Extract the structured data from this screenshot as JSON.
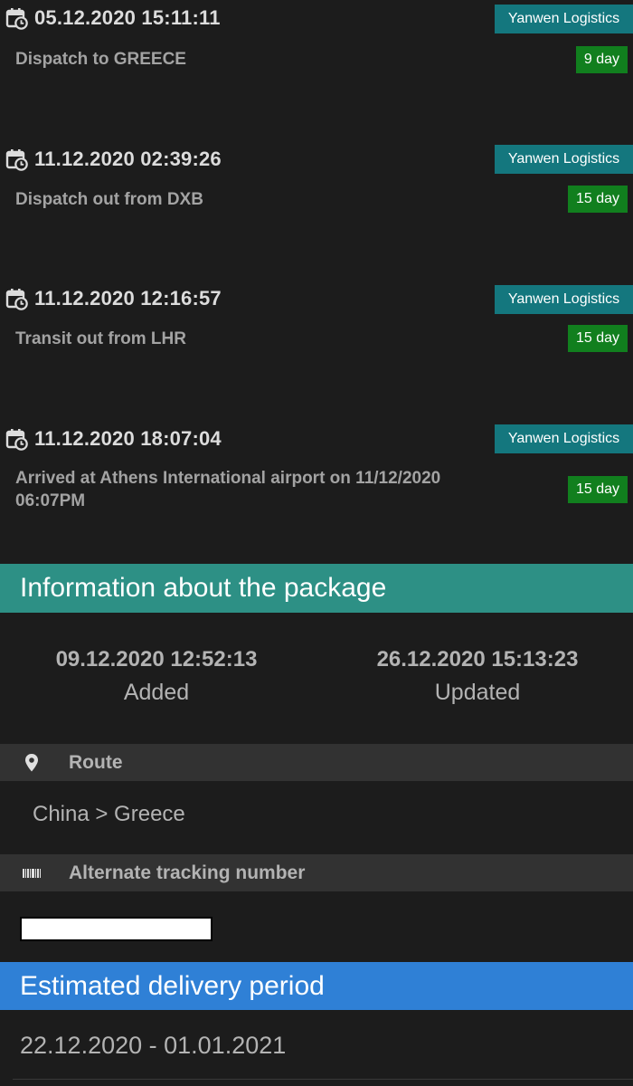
{
  "events": [
    {
      "date": "05.12.2020 15:11:11",
      "carrier": "Yanwen Logistics",
      "description": "Dispatch to GREECE",
      "days": "9 day"
    },
    {
      "date": "11.12.2020 02:39:26",
      "carrier": "Yanwen Logistics",
      "description": "Dispatch out from DXB",
      "days": "15 day"
    },
    {
      "date": "11.12.2020 12:16:57",
      "carrier": "Yanwen Logistics",
      "description": "Transit out from LHR",
      "days": "15 day"
    },
    {
      "date": "11.12.2020 18:07:04",
      "carrier": "Yanwen Logistics",
      "description": "Arrived at Athens International airport on 11/12/2020 06:07PM",
      "days": "15 day"
    }
  ],
  "package_info": {
    "title": "Information about the package",
    "added_date": "09.12.2020 12:52:13",
    "added_label": "Added",
    "updated_date": "26.12.2020 15:13:23",
    "updated_label": "Updated"
  },
  "route": {
    "label": "Route",
    "value": "China > Greece",
    "icon": "map-pin-icon"
  },
  "alternate_tracking": {
    "label": "Alternate tracking number",
    "icon": "barcode-icon"
  },
  "estimated_delivery": {
    "title": "Estimated delivery period",
    "value": "22.12.2020 - 01.01.2021"
  },
  "colors": {
    "background": "#1c1c1c",
    "carrier_badge": "#14777e",
    "days_badge": "#117f1e",
    "info_banner": "#2d9085",
    "estimate_banner": "#2f80d6",
    "section_header": "#323232"
  }
}
